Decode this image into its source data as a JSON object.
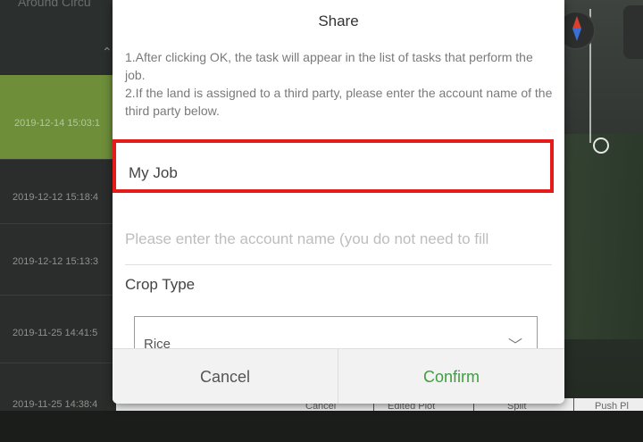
{
  "background": {
    "sidebar": {
      "ghost_title": "Around Circu",
      "selected_date": "2019-12-14 15:03:1",
      "rows": [
        "2019-12-12 15:18:4",
        "2019-12-12 15:13:3",
        "2019-11-25 14:41:5",
        "2019-11-25 14:38:4"
      ]
    },
    "bottom_bar": [
      "Cancel",
      "Edited Plot",
      "Split",
      "Push Pl"
    ]
  },
  "dialog": {
    "title": "Share",
    "instructions": [
      "1.After clicking OK, the task will appear in the list of tasks that perform the job.",
      "2.If the land is assigned to a third party, please enter the account name of the third party below."
    ],
    "job_name": "My Job",
    "account_placeholder": "Please enter the account name (you do not need to fill",
    "crop_type_label": "Crop Type",
    "crop_type_value": "Rice",
    "cancel_label": "Cancel",
    "confirm_label": "Confirm"
  },
  "colors": {
    "confirm": "#3f9e3f",
    "highlight": "#e51b1b",
    "selected_row": "#6e8e3a"
  }
}
